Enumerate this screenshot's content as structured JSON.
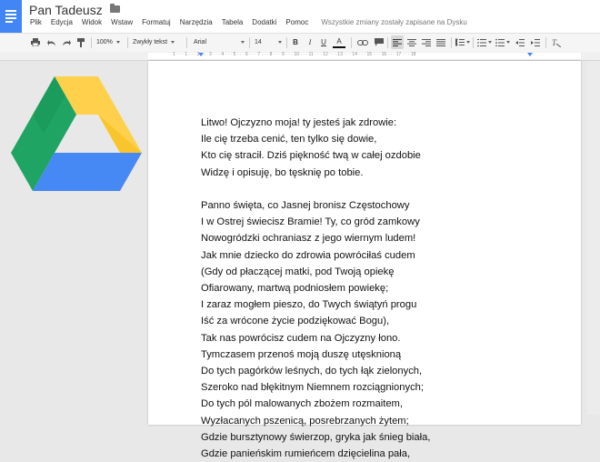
{
  "app": {
    "title": "Pan Tadeusz",
    "save_status": "Wszystkie zmiany zostały zapisane na Dysku"
  },
  "menu": [
    "Plik",
    "Edycja",
    "Widok",
    "Wstaw",
    "Formatuj",
    "Narzędzia",
    "Tabela",
    "Dodatki",
    "Pomoc"
  ],
  "toolbar": {
    "zoom": "100%",
    "style": "Zwykły tekst",
    "font": "Arial",
    "size": "14",
    "bold": "B",
    "italic": "I",
    "underline": "U",
    "text_color": "A"
  },
  "ruler": {
    "numbers": "1 · · · 1 · · · 2 · · · 3 · · · 4 · · · 5 · · · 6 · · · 7 · · · 8 · · · 9 · · · 10 · · · 11 · · · 12 · · · 13 · · · 14 · · · 15 · · · 16 · · · 17 · · · 18"
  },
  "document": {
    "lines": [
      "Litwo! Ojczyzno moja! ty jesteś jak zdrowie:",
      "Ile cię trzeba cenić, ten tylko się dowie,",
      "Kto cię stracił. Dziś piękność twą w całej ozdobie",
      "Widzę i opisuję, bo tęsknię po tobie.",
      "",
      "Panno święta, co Jasnej bronisz Częstochowy",
      "I w Ostrej świecisz Bramie! Ty, co gród zamkowy",
      "Nowogródzki ochraniasz z jego wiernym ludem!",
      "Jak mnie dziecko do zdrowia powróciłaś cudem",
      "(Gdy od płaczącej matki, pod Twoją opiekę",
      "Ofiarowany, martwą podniosłem powiekę;",
      "I zaraz mogłem pieszo, do Twych świątyń progu",
      "Iść za wrócone życie podziękować Bogu),",
      "Tak nas powrócisz cudem na Ojczyzny łono.",
      "Tymczasem przenoś moją duszę utęsknioną",
      "Do tych pagórków leśnych, do tych łąk zielonych,",
      "Szeroko nad błękitnym Niemnem rozciągnionych;",
      "Do tych pól malowanych zbożem rozmaitem,",
      "Wyzłacanych pszenicą, posrebrzanych żytem;",
      "Gdzie bursztynowy świerzop, gryka jak śnieg biała,",
      "Gdzie panieńskim rumieńcem dzięcielina pała,"
    ]
  },
  "colors": {
    "docs_blue": "#4285f4",
    "drive_green": "#1fa463",
    "drive_yellow": "#ffd04b",
    "drive_blue": "#4688f4"
  },
  "icons": [
    "docs-logo-icon",
    "folder-icon",
    "print-icon",
    "undo-icon",
    "redo-icon",
    "paint-format-icon",
    "link-icon",
    "comment-icon",
    "align-left-icon",
    "align-center-icon",
    "align-right-icon",
    "align-justify-icon",
    "line-spacing-icon",
    "numbered-list-icon",
    "bulleted-list-icon",
    "decrease-indent-icon",
    "increase-indent-icon",
    "clear-formatting-icon",
    "google-drive-logo"
  ]
}
